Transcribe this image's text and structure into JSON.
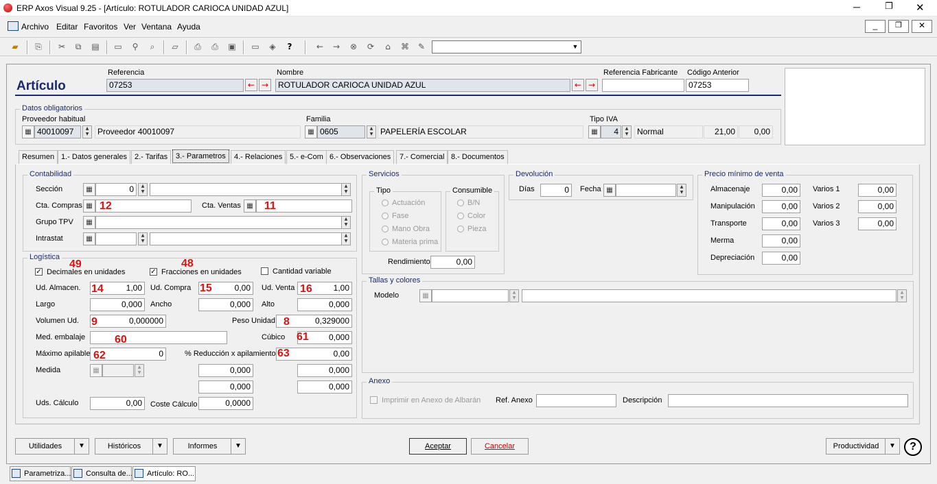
{
  "window": {
    "title": "ERP Axos Visual 9.25 - [Artículo: ROTULADOR CARIOCA UNIDAD AZUL]"
  },
  "menu": [
    "Archivo",
    "Editar",
    "Favoritos",
    "Ver",
    "Ventana",
    "Ayuda"
  ],
  "header": {
    "title": "Artículo",
    "ref_label": "Referencia",
    "ref_value": "07253",
    "nombre_label": "Nombre",
    "nombre_value": "ROTULADOR CARIOCA UNIDAD AZUL",
    "ref_fab_label": "Referencia Fabricante",
    "ref_fab_value": "",
    "cod_ant_label": "Código Anterior",
    "cod_ant_value": "07253"
  },
  "obligatorios": {
    "title": "Datos obligatorios",
    "prov_label": "Proveedor habitual",
    "prov_code": "40010097",
    "prov_name": "Proveedor 40010097",
    "fam_label": "Familia",
    "fam_code": "0605",
    "fam_name": "PAPELERÍA ESCOLAR",
    "iva_label": "Tipo IVA",
    "iva_code": "4",
    "iva_name": "Normal",
    "iva_pct": "21,00",
    "iva_re": "0,00"
  },
  "tabs": [
    "Resumen",
    "1.- Datos generales",
    "2.- Tarifas",
    "3.- Parametros",
    "4.- Relaciones",
    "5.- e-Com",
    "6.- Observaciones",
    "7.- Comercial",
    "8.- Documentos"
  ],
  "contabilidad": {
    "title": "Contabilidad",
    "seccion": "Sección",
    "seccion_val": "0",
    "cta_compras": "Cta. Compras",
    "cta_ventas": "Cta. Ventas",
    "grupo_tpv": "Grupo TPV",
    "intrastat": "Intrastat"
  },
  "servicios": {
    "title": "Servicios",
    "tipo": "Tipo",
    "tipo_opts": [
      "Actuación",
      "Fase",
      "Mano Obra",
      "Materia prima"
    ],
    "consumible": "Consumible",
    "cons_opts": [
      "B/N",
      "Color",
      "Pieza"
    ],
    "rendimiento": "Rendimiento",
    "rendimiento_val": "0,00"
  },
  "devolucion": {
    "title": "Devolución",
    "dias": "Días",
    "dias_val": "0",
    "fecha": "Fecha"
  },
  "precio_min": {
    "title": "Precio mínimo de venta",
    "rows": [
      {
        "label": "Almacenaje",
        "value": "0,00"
      },
      {
        "label": "Manipulación",
        "value": "0,00"
      },
      {
        "label": "Transporte",
        "value": "0,00"
      },
      {
        "label": "Merma",
        "value": "0,00"
      },
      {
        "label": "Depreciación",
        "value": "0,00"
      }
    ],
    "varios": [
      {
        "label": "Varios 1",
        "value": "0,00"
      },
      {
        "label": "Varios 2",
        "value": "0,00"
      },
      {
        "label": "Varios 3",
        "value": "0,00"
      }
    ]
  },
  "logistica": {
    "title": "Logística",
    "dec_uds": "Decimales en unidades",
    "frac_uds": "Fracciones en unidades",
    "cant_var": "Cantidad variable",
    "ud_alm": "Ud. Almacen.",
    "ud_alm_val": "1,00",
    "ud_compra": "Ud. Compra",
    "ud_compra_val": "0,00",
    "ud_venta": "Ud. Venta",
    "ud_venta_val": "1,00",
    "largo": "Largo",
    "largo_val": "0,000",
    "ancho": "Ancho",
    "ancho_val": "0,000",
    "alto": "Alto",
    "alto_val": "0,000",
    "volumen": "Volumen Ud.",
    "volumen_val": "0,000000",
    "peso": "Peso Unidad",
    "peso_val": "0,329000",
    "med_emb": "Med. embalaje",
    "cubico": "Cúbico",
    "cubico_val": "0,000",
    "max_apil": "Máximo apilable",
    "max_apil_val": "0",
    "pct_red": "% Reducción x apilamiento",
    "pct_red_val": "0,00",
    "medida": "Medida",
    "m1": "0,000",
    "m2": "0,000",
    "m3": "0,000",
    "m4": "0,000",
    "uds_calc": "Uds. Cálculo",
    "uds_calc_val": "0,00",
    "coste_calc": "Coste Cálculo",
    "coste_calc_val": "0,0000"
  },
  "tallas": {
    "title": "Tallas y colores",
    "modelo": "Modelo"
  },
  "anexo": {
    "title": "Anexo",
    "imprimir": "Imprimir en Anexo de Albarán",
    "ref_anexo": "Ref. Anexo",
    "descripcion": "Descripción"
  },
  "annotations": {
    "a49": "49",
    "a48": "48",
    "a12": "12",
    "a11": "11",
    "a14": "14",
    "a15": "15",
    "a16": "16",
    "a9": "9",
    "a8": "8",
    "a60": "60",
    "a61": "61",
    "a62": "62",
    "a63": "63"
  },
  "buttons": {
    "utilidades": "Utilidades",
    "historicos": "Históricos",
    "informes": "Informes",
    "aceptar": "Aceptar",
    "cancelar": "Cancelar",
    "productividad": "Productividad"
  },
  "taskbar": [
    "Parametriza...",
    "Consulta de...",
    "Artículo: RO..."
  ]
}
